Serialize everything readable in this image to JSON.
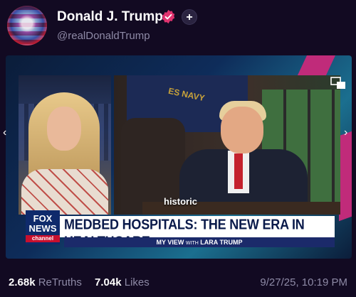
{
  "post": {
    "display_name": "Donald J. Trump",
    "handle": "@realDonaldTrump",
    "follow_icon": "plus-icon",
    "verified_color": "#e0336f"
  },
  "media": {
    "caption": "historic",
    "network_logo": [
      "FOX",
      "NEWS",
      "channel"
    ],
    "headline": "MEDBED HOSPITALS: THE NEW ERA IN HEALTHCARE",
    "subbar_show": "MY VIEW",
    "subbar_with": "WITH",
    "subbar_host": "LARA TRUMP",
    "flag_text": "ES NAVY"
  },
  "stats": {
    "retruths_count": "2.68k",
    "retruths_label": "ReTruths",
    "likes_count": "7.04k",
    "likes_label": "Likes",
    "timestamp": "9/27/25, 10:19 PM"
  },
  "colors": {
    "background": "#120a22",
    "muted_text": "#8e8aa6",
    "accent_pink": "#c02b7a"
  }
}
